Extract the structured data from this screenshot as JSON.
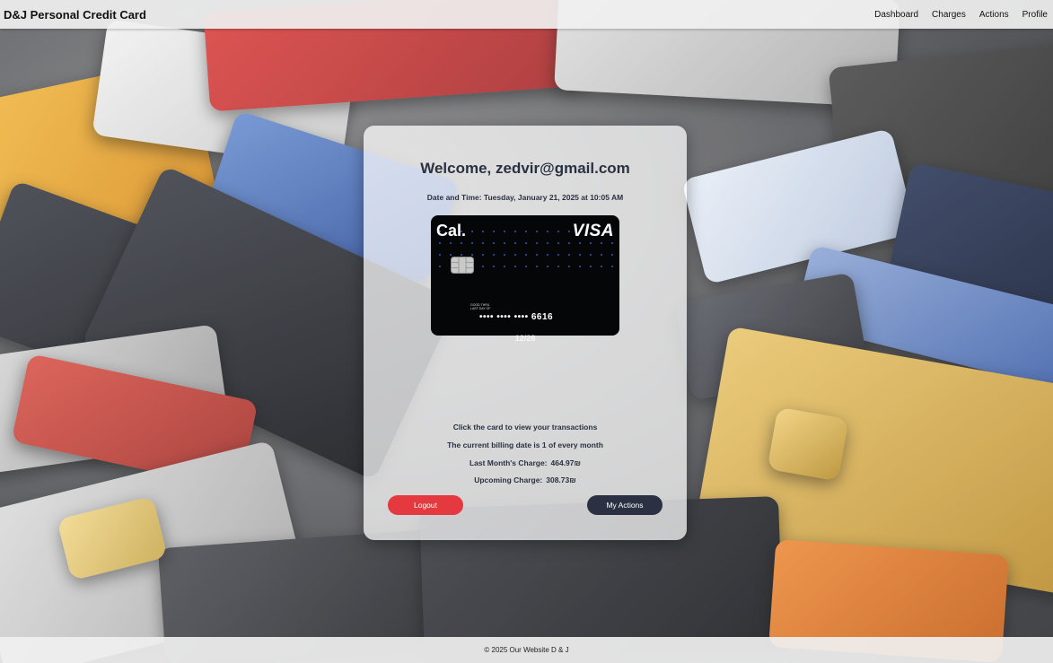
{
  "header": {
    "brand": "D&J Personal Credit Card",
    "nav": [
      "Dashboard",
      "Charges",
      "Actions",
      "Profile"
    ]
  },
  "panel": {
    "welcome": "Welcome, zedvir@gmail.com",
    "datetime": "Date and Time: Tuesday, January 21, 2025 at 10:05 AM",
    "card": {
      "brand": "Cal.",
      "network": "VISA",
      "small_text_1": "GOOD THRU",
      "small_text_2": "LAST DAY OF",
      "number": "•••• •••• •••• 6616",
      "expiry": "12/28"
    },
    "click_hint": "Click the card to view your transactions",
    "billing_date": "The current billing date is 1 of every month",
    "last_month_label": "Last Month's Charge:",
    "last_month_value": "464.97₪",
    "upcoming_label": "Upcoming Charge:",
    "upcoming_value": "308.73₪",
    "logout_label": "Logout",
    "actions_label": "My Actions"
  },
  "footer": {
    "text": "© 2025 Our Website D & J"
  },
  "colors": {
    "logout": "#e4393f",
    "actions": "#2b3142",
    "text": "#2a3140"
  }
}
